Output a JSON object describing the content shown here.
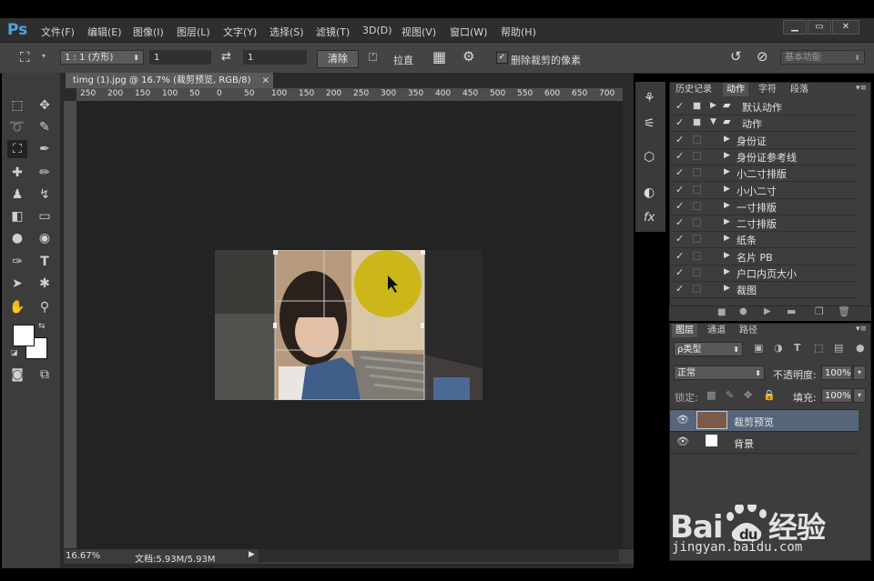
{
  "menu": {
    "logo": "Ps",
    "items": [
      "文件(F)",
      "编辑(E)",
      "图像(I)",
      "图层(L)",
      "文字(Y)",
      "选择(S)",
      "滤镜(T)",
      "3D(D)",
      "视图(V)",
      "窗口(W)",
      "帮助(H)"
    ]
  },
  "options": {
    "ratio": "1 : 1 (方形)",
    "width": "1",
    "height": "1",
    "clear": "清除",
    "straighten": "拉直",
    "delete_cropped": "删除裁剪的像素",
    "workspace": "基本功能"
  },
  "document": {
    "tab": "timg (1).jpg @ 16.7% (裁剪预览, RGB/8)",
    "ruler": [
      "250",
      "200",
      "150",
      "100",
      "50",
      "0",
      "50",
      "100",
      "150",
      "200",
      "250",
      "300",
      "350",
      "400",
      "450",
      "500",
      "550",
      "600",
      "650",
      "700"
    ],
    "zoom": "16.67%",
    "doc_size": "文档:5.93M/5.93M"
  },
  "panels": {
    "top_tabs": [
      "历史记录",
      "动作",
      "字符",
      "段落"
    ],
    "actions": [
      {
        "label": "默认动作",
        "folder": true,
        "open": false
      },
      {
        "label": "动作",
        "folder": true,
        "open": true
      },
      {
        "label": "身份证",
        "folder": false
      },
      {
        "label": "身份证参考线",
        "folder": false
      },
      {
        "label": "小二寸排版",
        "folder": false
      },
      {
        "label": "小小二寸",
        "folder": false
      },
      {
        "label": "一寸排版",
        "folder": false
      },
      {
        "label": "二寸排版",
        "folder": false
      },
      {
        "label": "纸条",
        "folder": false
      },
      {
        "label": "名片 PB",
        "folder": false
      },
      {
        "label": "户口内页大小",
        "folder": false
      },
      {
        "label": "裁图",
        "folder": false
      }
    ],
    "layer_tabs": [
      "图层",
      "通道",
      "路径"
    ],
    "kind": "ρ类型",
    "blend": "正常",
    "opacity_label": "不透明度:",
    "opacity": "100%",
    "lock_label": "锁定:",
    "fill_label": "填充:",
    "fill": "100%",
    "layers": [
      "裁剪预览",
      "背景"
    ]
  },
  "watermark": {
    "brand": "Bai du 经验",
    "url": "jingyan.baidu.com"
  },
  "colors": {
    "ps_blue": "#4aa6e6",
    "highlight": "#c8b400",
    "selected_layer": "#56657a"
  }
}
